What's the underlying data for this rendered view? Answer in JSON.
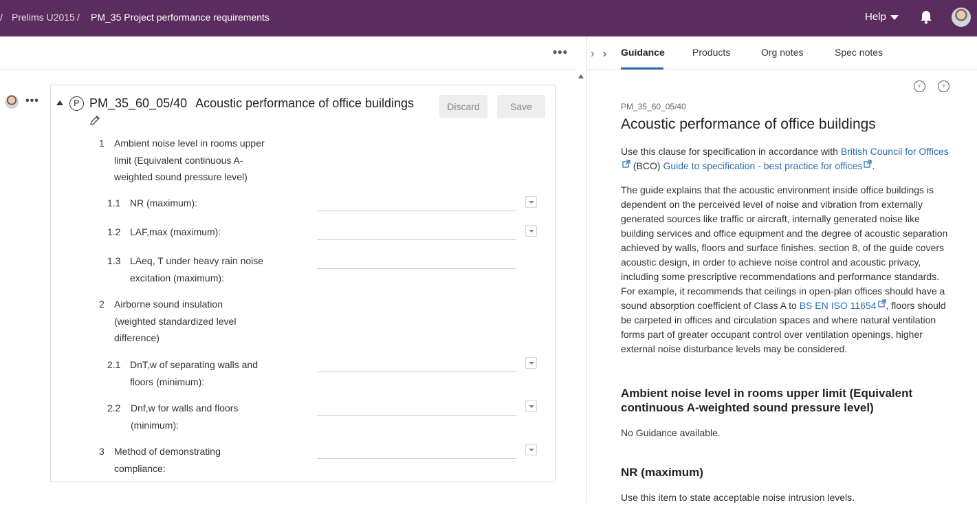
{
  "breadcrumb": {
    "separator": "/",
    "parent": "Prelims U2015",
    "current": "PM_35 Project performance requirements"
  },
  "header": {
    "help_label": "Help",
    "icons": [
      "caret-down-icon",
      "bell-icon",
      "avatar"
    ]
  },
  "editor": {
    "more_label": "•••",
    "user_more_label": "•••",
    "clause": {
      "badge": "P",
      "code": "PM_35_60_05/40",
      "title": "Acoustic performance of office buildings",
      "discard_label": "Discard",
      "save_label": "Save"
    },
    "items": [
      {
        "num": "1",
        "text": "Ambient noise level in rooms upper limit (Equivalent continuous A-weighted sound pressure level)"
      },
      {
        "num": "1.1",
        "text": "NR (maximum):"
      },
      {
        "num": "1.2",
        "text": "LAF,max (maximum):"
      },
      {
        "num": "1.3",
        "text": "LAeq, T under heavy rain noise excitation (maximum):"
      },
      {
        "num": "2",
        "text": "Airborne sound insulation (weighted standardized level difference)"
      },
      {
        "num": "2.1",
        "text": "DnT,w of separating walls and floors (minimum):"
      },
      {
        "num": "2.2",
        "text": "Dnf,w for walls and floors (minimum):"
      },
      {
        "num": "3",
        "text": "Method of demonstrating compliance:"
      }
    ]
  },
  "guidance_panel": {
    "tabs": [
      "Guidance",
      "Products",
      "Org notes",
      "Spec notes"
    ],
    "active_tab": "Guidance",
    "code": "PM_35_60_05/40",
    "title": "Acoustic performance of office buildings",
    "intro": {
      "pre": "Use this clause for specification in accordance with ",
      "link1": "British Council for Offices",
      "mid": " (BCO) ",
      "link2": "Guide to specification - best practice for offices",
      "post": "."
    },
    "body": {
      "pre": "The guide explains that the acoustic environment inside office buildings is dependent on the perceived level of noise and vibration from externally generated sources like traffic or aircraft, internally generated noise like building services and office equipment and the degree of acoustic separation achieved by walls, floors and surface finishes. section 8, of the guide covers acoustic design, in order to achieve noise control and acoustic privacy, including some prescriptive recommendations and performance standards. For example, it recommends that ceilings in open-plan offices should have a sound absorption coefficient of Class A to ",
      "link": "BS EN ISO 11654",
      "post": ", floors should be carpeted in offices and circulation spaces and where natural ventilation forms part of greater occupant control over ventilation openings, higher external noise disturbance levels may be considered."
    },
    "section1_heading": "Ambient noise level in rooms upper limit (Equivalent continuous A-weighted sound pressure level)",
    "section1_text": "No Guidance available.",
    "section2_heading": "NR (maximum)",
    "section2_text": "Use this item to state acceptable noise intrusion levels.",
    "nav_prev": "‹",
    "nav_next": "›"
  },
  "colors": {
    "topbar": "#5b2d5e",
    "link": "#2a6bb0",
    "tab_underline": "#2a6bb0"
  }
}
